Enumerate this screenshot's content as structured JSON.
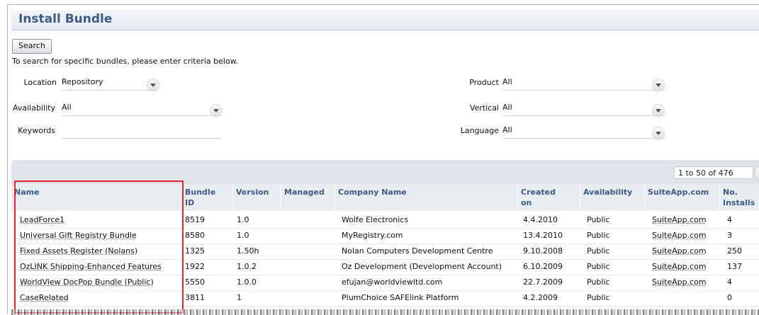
{
  "page": {
    "title": "Install Bundle"
  },
  "search": {
    "button_label": "Search",
    "hint": "To search for specific bundles, please enter criteria below."
  },
  "filters": {
    "location": {
      "label": "Location",
      "value": "Repository"
    },
    "availability": {
      "label": "Availability",
      "value": "All"
    },
    "keywords": {
      "label": "Keywords",
      "value": ""
    },
    "product": {
      "label": "Product",
      "value": "All"
    },
    "vertical": {
      "label": "Vertical",
      "value": "All"
    },
    "language": {
      "label": "Language",
      "value": "All"
    }
  },
  "pager": {
    "value": "1 to 50 of 476"
  },
  "table": {
    "headers": {
      "name": "Name",
      "bundle_id_1": "Bundle",
      "bundle_id_2": "ID",
      "version": "Version",
      "managed": "Managed",
      "company": "Company Name",
      "created_1": "Created",
      "created_2": "on",
      "availability": "Availability",
      "suiteapp": "SuiteApp.com",
      "installs_1": "No.",
      "installs_2": "Installs"
    },
    "rows": [
      {
        "name": "LeadForce1",
        "bundle_id": "8519",
        "version": "1.0",
        "managed": "",
        "company": "Wolfe Electronics",
        "created": "4.4.2010",
        "availability": "Public",
        "suiteapp": "SuiteApp.com",
        "installs": "4"
      },
      {
        "name": "Universal Gift Registry Bundle",
        "bundle_id": "8580",
        "version": "1.0",
        "managed": "",
        "company": "MyRegistry.com",
        "created": "13.4.2010",
        "availability": "Public",
        "suiteapp": "SuiteApp.com",
        "installs": "3"
      },
      {
        "name": "Fixed Assets Register (Nolans)",
        "bundle_id": "1325",
        "version": "1.50h",
        "managed": "",
        "company": "Nolan Computers Development Centre",
        "created": "9.10.2008",
        "availability": "Public",
        "suiteapp": "SuiteApp.com",
        "installs": "250"
      },
      {
        "name": "OzLINK Shipping-Enhanced Features",
        "bundle_id": "1922",
        "version": "1.0.2",
        "managed": "",
        "company": "Oz Development (Development Account)",
        "created": "6.10.2009",
        "availability": "Public",
        "suiteapp": "SuiteApp.com",
        "installs": "137"
      },
      {
        "name": "WorldView DocPop Bundle (Public)",
        "bundle_id": "5550",
        "version": "1.0.0",
        "managed": "",
        "company": "efujan@worldviewltd.com",
        "created": "22.7.2009",
        "availability": "Public",
        "suiteapp": "SuiteApp.com",
        "installs": "4"
      },
      {
        "name": "CaseRelated",
        "bundle_id": "3811",
        "version": "1",
        "managed": "",
        "company": "PlumChoice SAFElink Platform",
        "created": "4.2.2009",
        "availability": "Public",
        "suiteapp": "",
        "installs": "0"
      }
    ]
  },
  "colors": {
    "header_text": "#3c5b83",
    "highlight_border": "#e4262a"
  },
  "icons": {
    "dropdown": "chevron-down-icon"
  }
}
